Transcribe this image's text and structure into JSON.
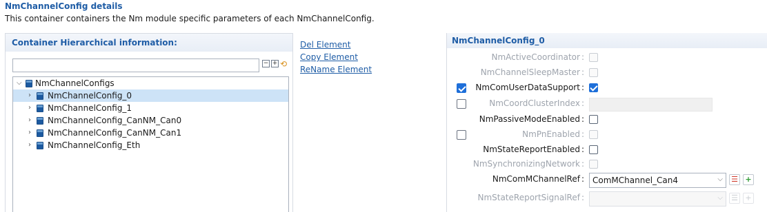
{
  "header": {
    "title": "NmChannelConfig details",
    "description": "This container containers the Nm module specific parameters of each NmChannelConfig."
  },
  "left_panel": {
    "heading": "Container Hierarchical information:",
    "filter_value": "",
    "tree": {
      "root": "NmChannelConfigs",
      "children": [
        "NmChannelConfig_0",
        "NmChannelConfig_1",
        "NmChannelConfig_CanNM_Can0",
        "NmChannelConfig_CanNM_Can1",
        "NmChannelConfig_Eth"
      ],
      "selected": "NmChannelConfig_0"
    }
  },
  "actions": {
    "del": "Del Element",
    "copy": "Copy Element",
    "rename": "ReName Element"
  },
  "details": {
    "title": "NmChannelConfig_0",
    "params": [
      {
        "label": "NmActiveCoordinator",
        "type": "checkbox",
        "enabled": false,
        "checked": false
      },
      {
        "label": "NmChannelSleepMaster",
        "type": "checkbox",
        "enabled": false,
        "checked": false
      },
      {
        "label": "NmComUserDataSupport",
        "type": "checkbox",
        "enabled": true,
        "checked": true,
        "left_checked": true
      },
      {
        "label": "NmCoordClusterIndex",
        "type": "text",
        "enabled": false,
        "value": ""
      },
      {
        "label": "NmPassiveModeEnabled",
        "type": "checkbox",
        "enabled": true,
        "checked": false
      },
      {
        "label": "NmPnEnabled",
        "type": "checkbox",
        "enabled": false,
        "checked": false
      },
      {
        "label": "NmStateReportEnabled",
        "type": "checkbox",
        "enabled": true,
        "checked": false
      },
      {
        "label": "NmSynchronizingNetwork",
        "type": "checkbox",
        "enabled": false,
        "checked": false
      },
      {
        "label": "NmComMChannelRef",
        "type": "select",
        "enabled": true,
        "value": "ComMChannel_Can4"
      },
      {
        "label": "NmStateReportSignalRef",
        "type": "select",
        "enabled": false,
        "value": ""
      }
    ]
  },
  "colors": {
    "accent": "#1f5da6",
    "selected_row": "#cde3f7",
    "checkbox_on": "#1e6fd9"
  }
}
